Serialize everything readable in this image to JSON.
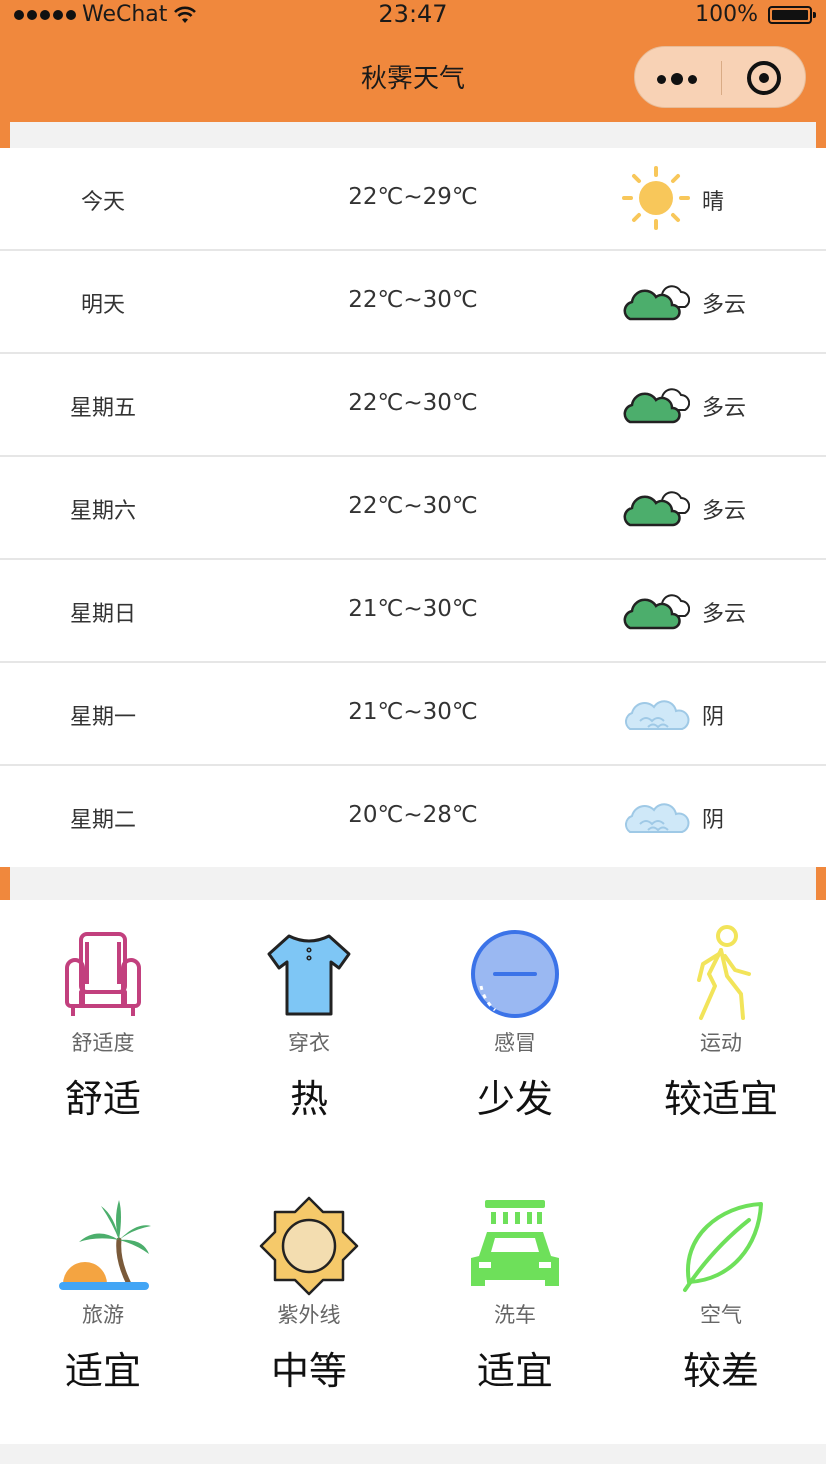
{
  "status_bar": {
    "carrier": "WeChat",
    "time": "23:47",
    "battery": "100%"
  },
  "nav": {
    "title": "秋霁天气"
  },
  "forecast": [
    {
      "day": "今天",
      "temp": "22℃~29℃",
      "condition": "晴",
      "icon": "sun-icon"
    },
    {
      "day": "明天",
      "temp": "22℃~30℃",
      "condition": "多云",
      "icon": "partly-cloudy-icon"
    },
    {
      "day": "星期五",
      "temp": "22℃~30℃",
      "condition": "多云",
      "icon": "partly-cloudy-icon"
    },
    {
      "day": "星期六",
      "temp": "22℃~30℃",
      "condition": "多云",
      "icon": "partly-cloudy-icon"
    },
    {
      "day": "星期日",
      "temp": "21℃~30℃",
      "condition": "多云",
      "icon": "partly-cloudy-icon"
    },
    {
      "day": "星期一",
      "temp": "21℃~30℃",
      "condition": "阴",
      "icon": "overcast-cloud-icon"
    },
    {
      "day": "星期二",
      "temp": "20℃~28℃",
      "condition": "阴",
      "icon": "overcast-cloud-icon"
    }
  ],
  "indices": [
    {
      "label": "舒适度",
      "value": "舒适",
      "icon": "armchair-icon"
    },
    {
      "label": "穿衣",
      "value": "热",
      "icon": "tshirt-icon"
    },
    {
      "label": "感冒",
      "value": "少发",
      "icon": "minus-circle-icon"
    },
    {
      "label": "运动",
      "value": "较适宜",
      "icon": "walking-person-icon"
    },
    {
      "label": "旅游",
      "value": "适宜",
      "icon": "palm-beach-icon"
    },
    {
      "label": "紫外线",
      "value": "中等",
      "icon": "uv-sun-icon"
    },
    {
      "label": "洗车",
      "value": "适宜",
      "icon": "car-wash-icon"
    },
    {
      "label": "空气",
      "value": "较差",
      "icon": "leaf-icon"
    }
  ],
  "colors": {
    "accent": "#f0883d",
    "capsule": "#f8d2b5",
    "sun": "#f8c75a",
    "cloud_green": "#4cae6c",
    "cloud_blue": "#bfe0f5"
  }
}
